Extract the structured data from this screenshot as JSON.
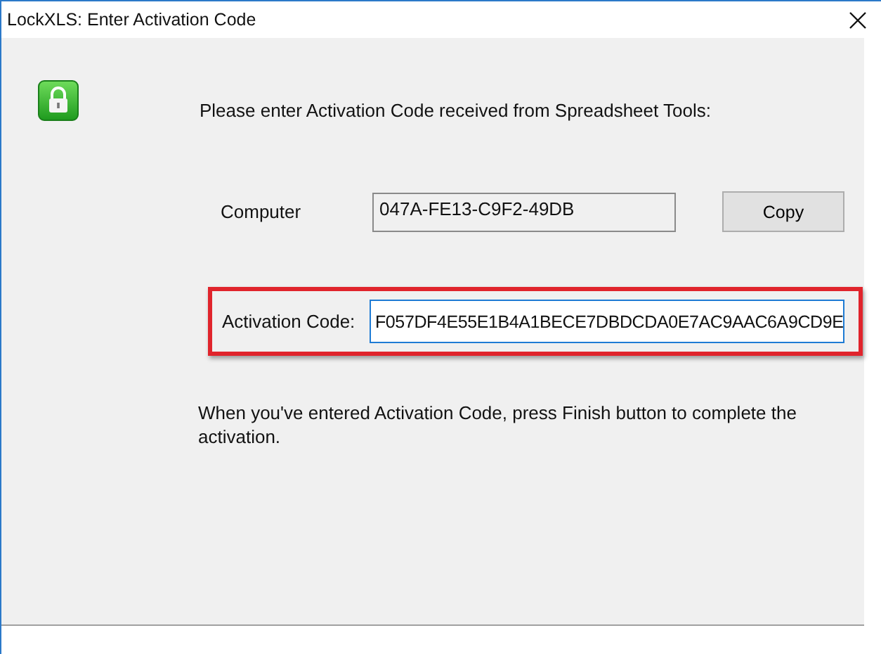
{
  "window": {
    "title": "LockXLS: Enter Activation Code"
  },
  "prompt": "Please enter Activation Code received from Spreadsheet Tools:",
  "computer": {
    "label": "Computer",
    "value": "047A-FE13-C9F2-49DB",
    "button": "Copy"
  },
  "activation": {
    "label": "Activation Code:",
    "value": "F057DF4E55E1B4A1BECE7DBDCDA0E7AC9AAC6A9CD9E",
    "highlighted": true
  },
  "note": "When you've entered Activation Code, press Finish button to complete the activation."
}
